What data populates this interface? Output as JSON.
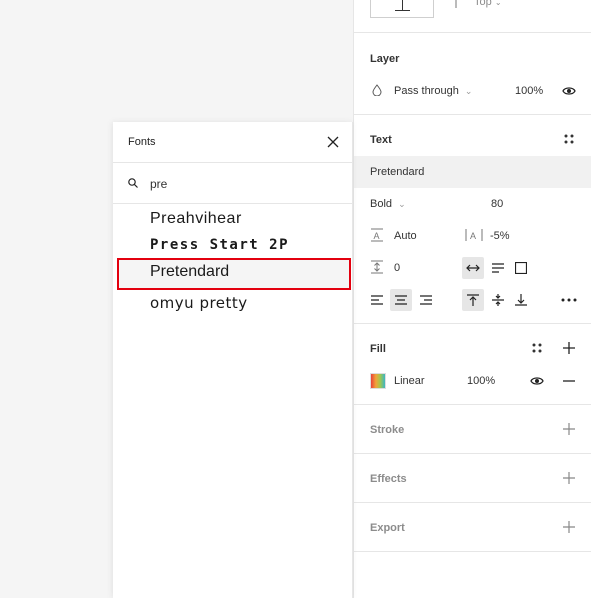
{
  "layer": {
    "title": "Layer",
    "blend_mode": "Pass through",
    "opacity": "100%"
  },
  "alignment_top": {
    "label": "Top"
  },
  "text": {
    "title": "Text",
    "font_family": "Pretendard",
    "weight": "Bold",
    "size": "80",
    "line_height": "Auto",
    "letter_spacing": "-5%",
    "paragraph_spacing": "0"
  },
  "fill": {
    "title": "Fill",
    "type": "Linear",
    "opacity": "100%"
  },
  "stroke": {
    "title": "Stroke"
  },
  "effects": {
    "title": "Effects"
  },
  "export": {
    "title": "Export"
  },
  "fonts_popover": {
    "title": "Fonts",
    "search_value": "pre",
    "results": [
      "Preahvihear",
      "Press Start 2P",
      "Pretendard",
      "omyu pretty"
    ],
    "selected_index": 2
  },
  "colors": {
    "highlight": "#e3000f",
    "panel_bg": "#ffffff",
    "canvas_bg": "#f5f5f5"
  }
}
